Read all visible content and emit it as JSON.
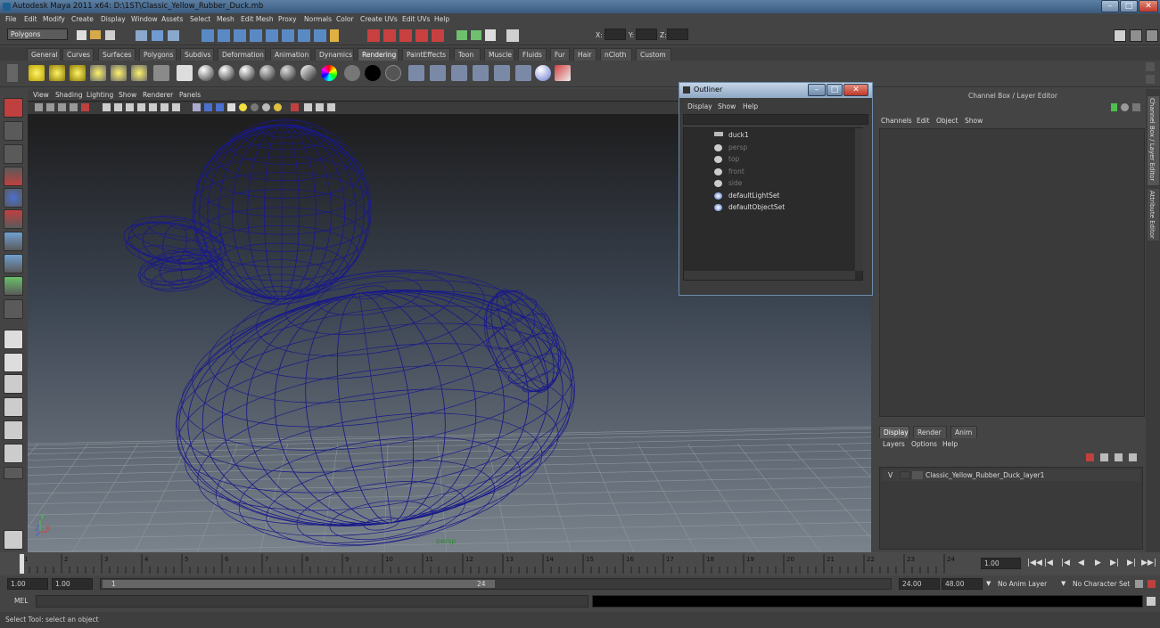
{
  "window": {
    "title": "Autodesk Maya 2011 x64: D:\\1ST\\Classic_Yellow_Rubber_Duck.mb",
    "min": "–",
    "max": "□",
    "close": "✕"
  },
  "menubar": [
    "File",
    "Edit",
    "Modify",
    "Create",
    "Display",
    "Window",
    "Assets",
    "Select",
    "Mesh",
    "Edit Mesh",
    "Proxy",
    "Normals",
    "Color",
    "Create UVs",
    "Edit UVs",
    "Help"
  ],
  "statusline": {
    "mode": "Polygons",
    "x_label": "X:",
    "y_label": "Y:",
    "z_label": "Z:"
  },
  "shelf_tabs": [
    "General",
    "Curves",
    "Surfaces",
    "Polygons",
    "Subdivs",
    "Deformation",
    "Animation",
    "Dynamics",
    "Rendering",
    "PaintEffects",
    "Toon",
    "Muscle",
    "Fluids",
    "Fur",
    "Hair",
    "nCloth",
    "Custom"
  ],
  "active_shelf_tab": "Rendering",
  "viewport": {
    "menus": [
      "View",
      "Shading",
      "Lighting",
      "Show",
      "Renderer",
      "Panels"
    ],
    "camera_label": "persp",
    "axis": {
      "y": "Y",
      "x": "X",
      "z": "Z"
    },
    "wire_color": "#1a1a8a"
  },
  "outliner": {
    "title": "Outliner",
    "menus": [
      "Display",
      "Show",
      "Help"
    ],
    "items": [
      {
        "label": "duck1",
        "dim": false
      },
      {
        "label": "persp",
        "dim": true
      },
      {
        "label": "top",
        "dim": true
      },
      {
        "label": "front",
        "dim": true
      },
      {
        "label": "side",
        "dim": true
      },
      {
        "label": "defaultLightSet",
        "dim": false
      },
      {
        "label": "defaultObjectSet",
        "dim": false
      }
    ]
  },
  "channel_box": {
    "title": "Channel Box / Layer Editor",
    "menus": [
      "Channels",
      "Edit",
      "Object",
      "Show"
    ]
  },
  "side_tabs": [
    "Channel Box / Layer Editor",
    "Attribute Editor"
  ],
  "layer_editor": {
    "tabs": [
      "Display",
      "Render",
      "Anim"
    ],
    "menus": [
      "Layers",
      "Options",
      "Help"
    ],
    "layer": {
      "visible": "V",
      "name": "Classic_Yellow_Rubber_Duck_layer1"
    }
  },
  "timeline": {
    "ticks": [
      "1",
      "2",
      "3",
      "4",
      "5",
      "6",
      "7",
      "8",
      "9",
      "10",
      "11",
      "12",
      "13",
      "14",
      "15",
      "16",
      "17",
      "18",
      "19",
      "20",
      "21",
      "22",
      "23",
      "24"
    ],
    "current": "1.00"
  },
  "range": {
    "start": "1.00",
    "start2": "1.00",
    "slider_start": "1",
    "slider_end": "24",
    "end": "24.00",
    "end2": "48.00",
    "anim_layer": "No Anim Layer",
    "char_set": "No Character Set"
  },
  "command": {
    "label": "MEL"
  },
  "help": {
    "text": "Select Tool: select an object"
  }
}
